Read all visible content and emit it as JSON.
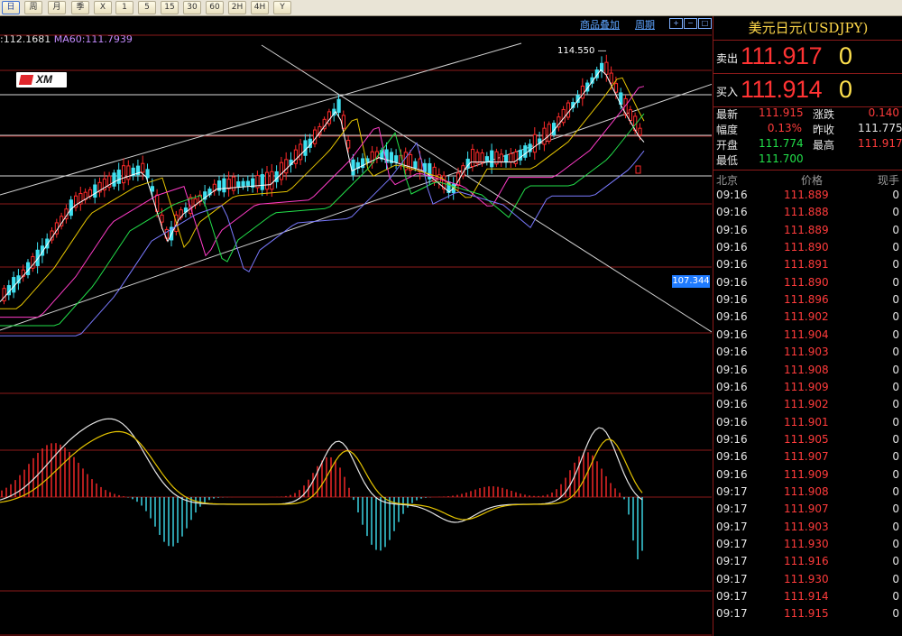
{
  "toolbar": {
    "buttons": [
      {
        "label": "日",
        "selected": true
      },
      {
        "label": "周",
        "selected": false
      },
      {
        "label": "月",
        "selected": false
      },
      {
        "label": "季",
        "selected": false
      },
      {
        "label": "X",
        "selected": false
      },
      {
        "label": "1",
        "selected": false
      },
      {
        "label": "5",
        "selected": false
      },
      {
        "label": "15",
        "selected": false
      },
      {
        "label": "30",
        "selected": false
      },
      {
        "label": "60",
        "selected": false
      },
      {
        "label": "2H",
        "selected": false
      },
      {
        "label": "4H",
        "selected": false
      },
      {
        "label": "Y",
        "selected": false
      }
    ]
  },
  "chart_header": {
    "overlay_link": "商品叠加",
    "period_link": "周期",
    "ma_readout_a": ":112.1681",
    "ma_readout_b": "MA60:111.7939"
  },
  "chart_overlay": {
    "high_label": "114.550",
    "price_tag": "107.344",
    "logo_text": "XM"
  },
  "colors": {
    "up": "#ff2a2a",
    "down": "#3fe0f0",
    "ma_short": "#ffffff",
    "ma_mid": "#e5c400",
    "ma_long1": "#ff3cc8",
    "ma_long2": "#22e04a",
    "ma_long3": "#7a7aff",
    "grid": "#8b1a1a"
  },
  "instrument": {
    "title": "美元日元(USDJPY)",
    "sell_label": "卖出",
    "sell_main": "111.917",
    "sell_tail": "0",
    "buy_label": "买入",
    "buy_main": "111.914",
    "buy_tail": "0"
  },
  "stats": {
    "latest_label": "最新",
    "latest": "111.915",
    "change_label": "涨跌",
    "change": "0.140",
    "range_label": "幅度",
    "range": "0.13%",
    "prevclose_label": "昨收",
    "prevclose": "111.775",
    "open_label": "开盘",
    "open": "111.774",
    "high_label": "最高",
    "high": "111.917",
    "low_label": "最低",
    "low": "111.700"
  },
  "ticks": {
    "head_time": "北京",
    "head_price": "价格",
    "head_vol": "现手",
    "rows": [
      {
        "time": "09:16",
        "price": "111.889",
        "vol": "0"
      },
      {
        "time": "09:16",
        "price": "111.888",
        "vol": "0"
      },
      {
        "time": "09:16",
        "price": "111.889",
        "vol": "0"
      },
      {
        "time": "09:16",
        "price": "111.890",
        "vol": "0"
      },
      {
        "time": "09:16",
        "price": "111.891",
        "vol": "0"
      },
      {
        "time": "09:16",
        "price": "111.890",
        "vol": "0"
      },
      {
        "time": "09:16",
        "price": "111.896",
        "vol": "0"
      },
      {
        "time": "09:16",
        "price": "111.902",
        "vol": "0"
      },
      {
        "time": "09:16",
        "price": "111.904",
        "vol": "0"
      },
      {
        "time": "09:16",
        "price": "111.903",
        "vol": "0"
      },
      {
        "time": "09:16",
        "price": "111.908",
        "vol": "0"
      },
      {
        "time": "09:16",
        "price": "111.909",
        "vol": "0"
      },
      {
        "time": "09:16",
        "price": "111.902",
        "vol": "0"
      },
      {
        "time": "09:16",
        "price": "111.901",
        "vol": "0"
      },
      {
        "time": "09:16",
        "price": "111.905",
        "vol": "0"
      },
      {
        "time": "09:16",
        "price": "111.907",
        "vol": "0"
      },
      {
        "time": "09:16",
        "price": "111.909",
        "vol": "0"
      },
      {
        "time": "09:17",
        "price": "111.908",
        "vol": "0"
      },
      {
        "time": "09:17",
        "price": "111.907",
        "vol": "0"
      },
      {
        "time": "09:17",
        "price": "111.903",
        "vol": "0"
      },
      {
        "time": "09:17",
        "price": "111.930",
        "vol": "0"
      },
      {
        "time": "09:17",
        "price": "111.916",
        "vol": "0"
      },
      {
        "time": "09:17",
        "price": "111.930",
        "vol": "0"
      },
      {
        "time": "09:17",
        "price": "111.914",
        "vol": "0"
      },
      {
        "time": "09:17",
        "price": "111.915",
        "vol": "0"
      }
    ]
  }
}
